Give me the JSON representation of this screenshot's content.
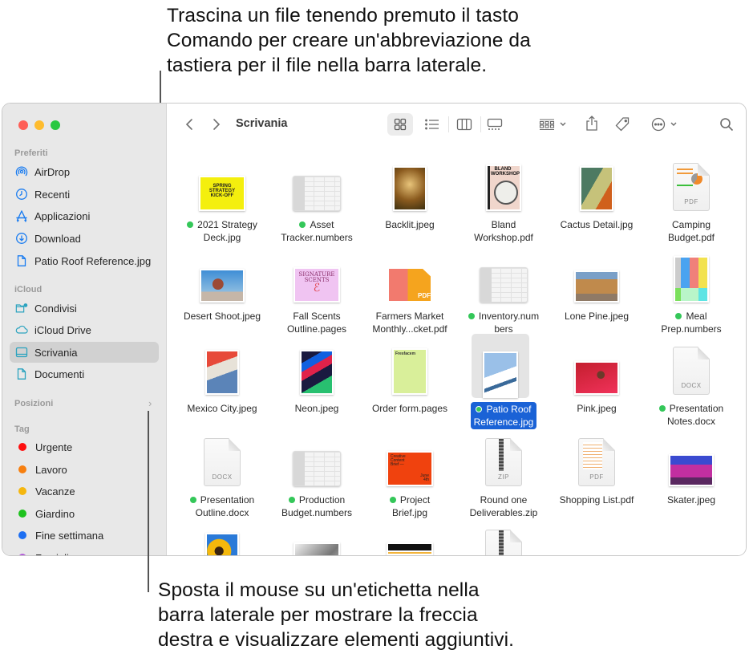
{
  "callouts": {
    "top": [
      "Trascina un file tenendo premuto il tasto",
      "Comando per creare un'abbreviazione da",
      "tastiera per il file nella barra laterale."
    ],
    "bottom": [
      "Sposta il mouse su un'etichetta nella",
      "barra laterale per mostrare la freccia",
      "destra e visualizzare elementi aggiuntivi."
    ]
  },
  "window": {
    "traffic_lights": {
      "close": "#fe5f57",
      "minimize": "#febc2e",
      "zoom": "#28c840"
    },
    "toolbar": {
      "back_icon": "chevron-left-icon",
      "forward_icon": "chevron-right-icon",
      "title": "Scrivania",
      "view_modes": [
        "icon-view",
        "list-view",
        "column-view",
        "gallery-view"
      ],
      "active_view": "icon-view",
      "group_icon": "group-by-icon",
      "share_icon": "share-icon",
      "tag_icon": "tag-icon",
      "more_icon": "more-actions-icon",
      "search_icon": "search-icon"
    },
    "sidebar": {
      "sections": {
        "favorites": "Preferiti",
        "icloud": "iCloud",
        "locations": "Posizioni",
        "tags": "Tag"
      },
      "favorites": [
        {
          "label": "AirDrop",
          "icon": "airdrop-icon"
        },
        {
          "label": "Recenti",
          "icon": "clock-icon"
        },
        {
          "label": "Applicazioni",
          "icon": "applications-icon"
        },
        {
          "label": "Download",
          "icon": "download-icon"
        },
        {
          "label": "Patio Roof Reference.jpg",
          "icon": "document-icon"
        }
      ],
      "icloud": [
        {
          "label": "Condivisi",
          "icon": "shared-folder-icon"
        },
        {
          "label": "iCloud Drive",
          "icon": "cloud-icon"
        },
        {
          "label": "Scrivania",
          "icon": "desktop-icon",
          "active": true
        },
        {
          "label": "Documenti",
          "icon": "document-icon"
        }
      ],
      "tags": [
        {
          "label": "Urgente",
          "color": "#fe0f0f"
        },
        {
          "label": "Lavoro",
          "color": "#f77f0f"
        },
        {
          "label": "Vacanze",
          "color": "#f5b70f"
        },
        {
          "label": "Giardino",
          "color": "#1ec21e"
        },
        {
          "label": "Fine settimana",
          "color": "#1d6ff2"
        },
        {
          "label": "Famiglia",
          "color": "#b25bd8"
        }
      ]
    },
    "files": [
      {
        "name": "2021 Strategy Deck.jpg",
        "lines": [
          "2021 Strategy",
          "Deck.jpg"
        ],
        "tagged": true,
        "kind": "yellow-slide"
      },
      {
        "name": "Asset Tracker.numbers",
        "lines": [
          "Asset",
          "Tracker.numbers"
        ],
        "tagged": true,
        "kind": "sheet"
      },
      {
        "name": "Backlit.jpeg",
        "lines": [
          "Backlit.jpeg"
        ],
        "tagged": false,
        "kind": "photo-portrait-gold"
      },
      {
        "name": "Bland Workshop.pdf",
        "lines": [
          "Bland",
          "Workshop.pdf"
        ],
        "tagged": false,
        "kind": "pdf-magazine"
      },
      {
        "name": "Cactus Detail.jpg",
        "lines": [
          "Cactus Detail.jpg"
        ],
        "tagged": false,
        "kind": "photo-cactus"
      },
      {
        "name": "Camping Budget.pdf",
        "lines": [
          "Camping",
          "Budget.pdf"
        ],
        "tagged": false,
        "kind": "pdf-chart"
      },
      {
        "name": "Desert Shoot.jpeg",
        "lines": [
          "Desert Shoot.jpeg"
        ],
        "tagged": false,
        "kind": "photo-desert"
      },
      {
        "name": "Fall Scents Outline.pages",
        "lines": [
          "Fall Scents",
          "Outline.pages"
        ],
        "tagged": false,
        "kind": "pages-pink"
      },
      {
        "name": "Farmers Market Monthly...cket.pdf",
        "lines": [
          "Farmers Market",
          "Monthly...cket.pdf"
        ],
        "tagged": false,
        "kind": "pdf-oranges"
      },
      {
        "name": "Inventory.numbers",
        "lines": [
          "Inventory.num",
          "bers"
        ],
        "tagged": true,
        "kind": "sheet"
      },
      {
        "name": "Lone Pine.jpeg",
        "lines": [
          "Lone Pine.jpeg"
        ],
        "tagged": false,
        "kind": "photo-rocks"
      },
      {
        "name": "Meal Prep.numbers",
        "lines": [
          "Meal",
          "Prep.numbers"
        ],
        "tagged": true,
        "kind": "sheet-colored"
      },
      {
        "name": "Mexico City.jpeg",
        "lines": [
          "Mexico City.jpeg"
        ],
        "tagged": false,
        "kind": "photo-mexico"
      },
      {
        "name": "Neon.jpeg",
        "lines": [
          "Neon.jpeg"
        ],
        "tagged": false,
        "kind": "photo-neon"
      },
      {
        "name": "Order form.pages",
        "lines": [
          "Order form.pages"
        ],
        "tagged": false,
        "kind": "pages-green"
      },
      {
        "name": "Patio Roof Reference.jpg",
        "lines": [
          "Patio Roof",
          "Reference.jpg"
        ],
        "tagged": true,
        "kind": "photo-patio",
        "selected": true
      },
      {
        "name": "Pink.jpeg",
        "lines": [
          "Pink.jpeg"
        ],
        "tagged": false,
        "kind": "photo-pink"
      },
      {
        "name": "Presentation Notes.docx",
        "lines": [
          "Presentation",
          "Notes.docx"
        ],
        "tagged": true,
        "kind": "docx",
        "ext": "DOCX"
      },
      {
        "name": "Presentation Outline.docx",
        "lines": [
          "Presentation",
          "Outline.docx"
        ],
        "tagged": true,
        "kind": "docx",
        "ext": "DOCX"
      },
      {
        "name": "Production Budget.numbers",
        "lines": [
          "Production",
          "Budget.numbers"
        ],
        "tagged": true,
        "kind": "sheet"
      },
      {
        "name": "Project Brief.jpg",
        "lines": [
          "Project",
          "Brief.jpg"
        ],
        "tagged": true,
        "kind": "orange-brief"
      },
      {
        "name": "Round one Deliverables.zip",
        "lines": [
          "Round one",
          "Deliverables.zip"
        ],
        "tagged": false,
        "kind": "zip",
        "ext": "ZIP"
      },
      {
        "name": "Shopping List.pdf",
        "lines": [
          "Shopping List.pdf"
        ],
        "tagged": false,
        "kind": "pdf-list",
        "ext": "PDF"
      },
      {
        "name": "Skater.jpeg",
        "lines": [
          "Skater.jpeg"
        ],
        "tagged": false,
        "kind": "photo-skater"
      },
      {
        "name": "",
        "lines": [],
        "tagged": false,
        "kind": "photo-sunflower"
      },
      {
        "name": "",
        "lines": [],
        "tagged": false,
        "kind": "photo-bw"
      },
      {
        "name": "",
        "lines": [],
        "tagged": false,
        "kind": "workout-sheet"
      },
      {
        "name": "",
        "lines": [],
        "tagged": false,
        "kind": "zip"
      }
    ],
    "thumb_texts": {
      "yellow_slide": [
        "SPRING",
        "STRATEGY",
        "KICK-OFF"
      ],
      "bland": "BLAND WORKSHOP",
      "camping_ext": "PDF",
      "signature": [
        "SIGNATURE",
        "SCENTS"
      ],
      "farmers_ext": "PDF",
      "brief": [
        "Creative",
        "Content",
        "Brief —"
      ],
      "brief_date": [
        "June",
        "4th"
      ],
      "order_title": "Fresfacem"
    }
  }
}
